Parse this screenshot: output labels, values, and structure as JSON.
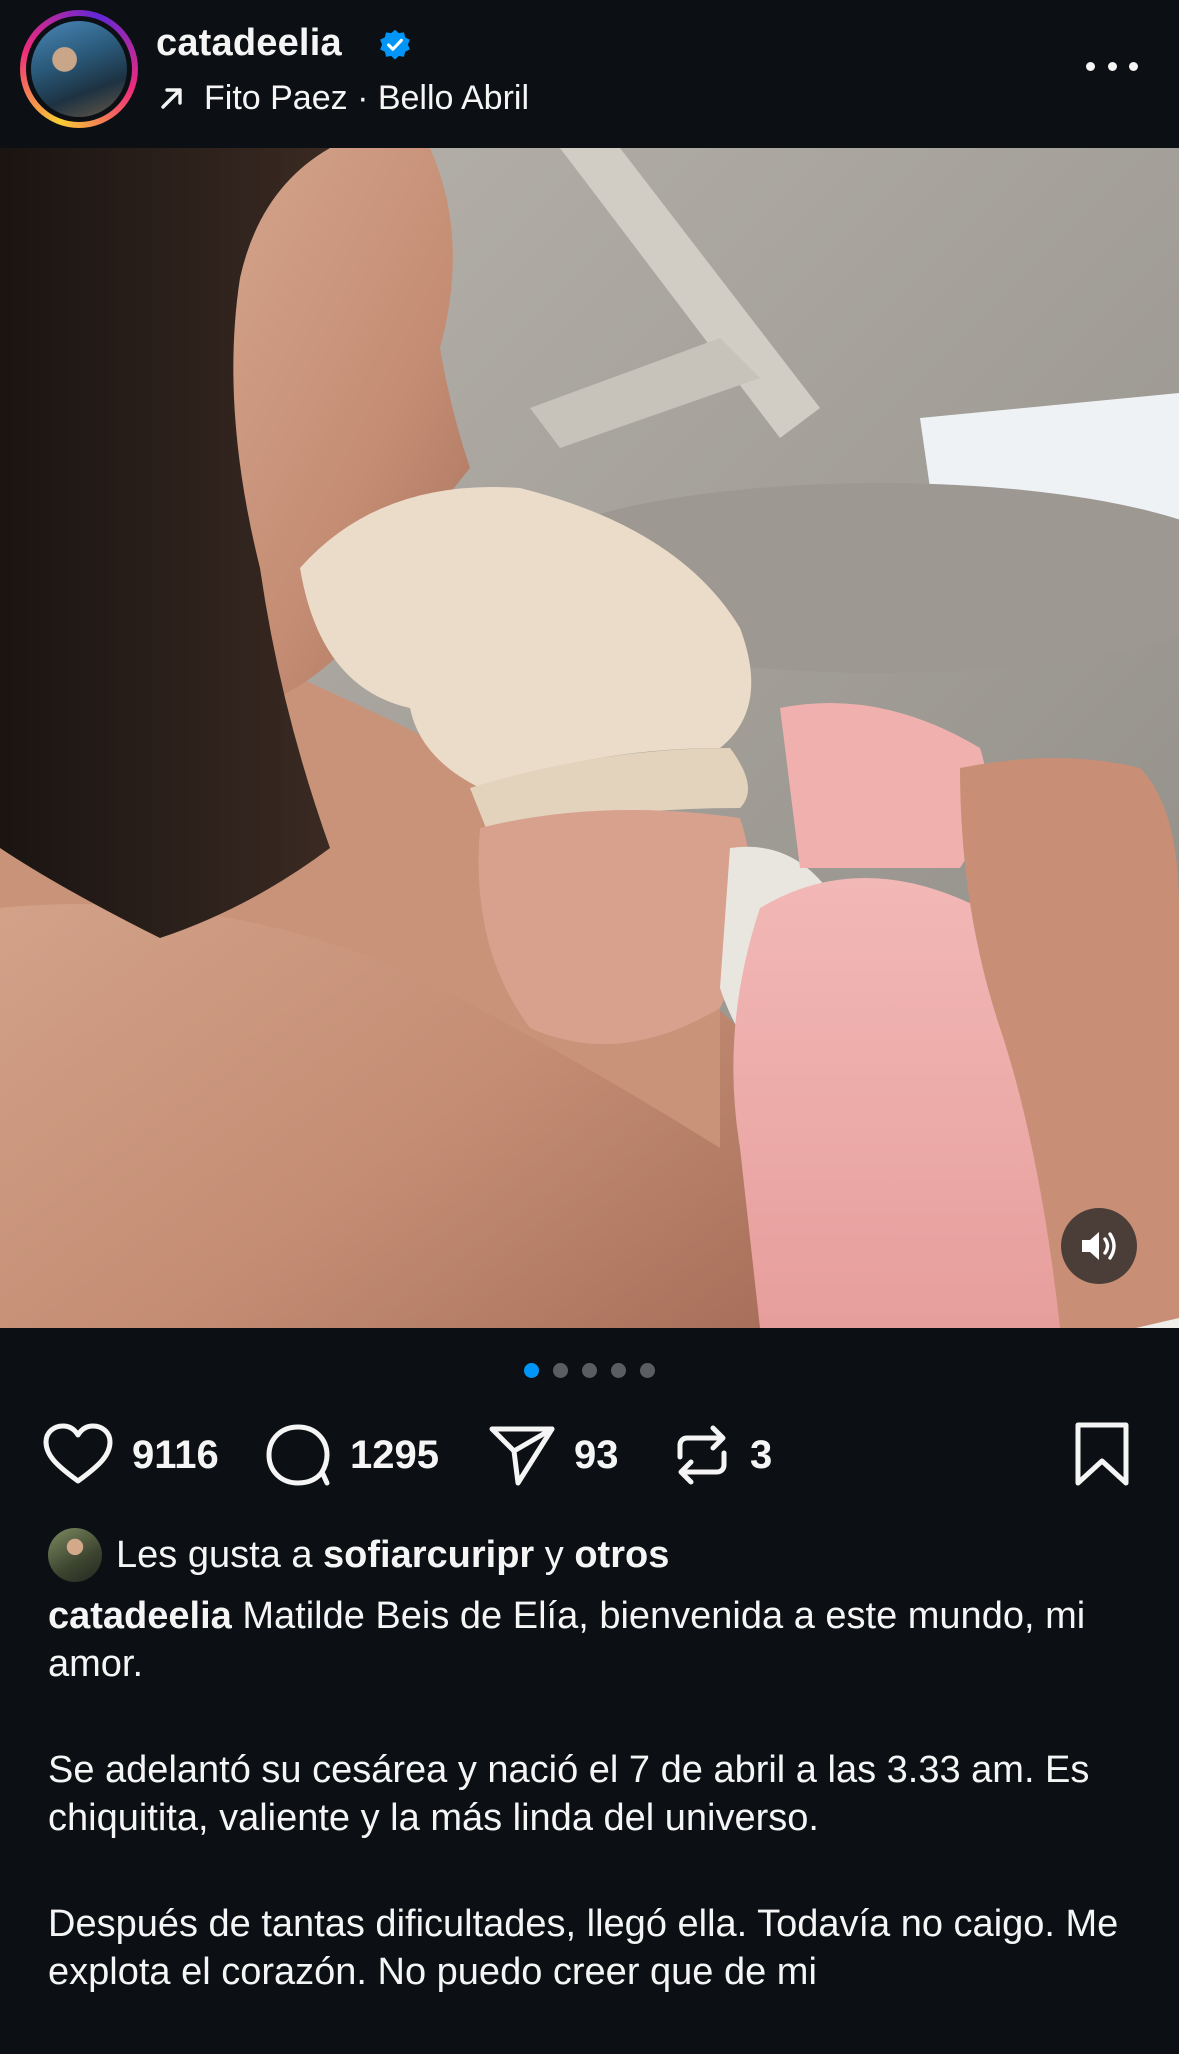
{
  "header": {
    "username": "catadeelia",
    "verified": true,
    "audio": "Fito Paez · Bello Abril"
  },
  "carousel": {
    "total": 5,
    "active_index": 0
  },
  "actions": {
    "likes": "9116",
    "comments": "1295",
    "shares": "93",
    "reposts": "3"
  },
  "liked_by": {
    "prefix": "Les gusta a",
    "user": "sofiarcuripr",
    "connector": "y",
    "others": "otros"
  },
  "caption": {
    "username": "catadeelia",
    "paragraphs": [
      "Matilde Beis de Elía, bienvenida a este mundo, mi amor.",
      "Se adelantó su cesárea y nació el 7 de abril a las 3.33 am. Es chiquitita, valiente y la más linda del universo.",
      "Después de tantas dificultades, llegó ella. Todavía no caigo. Me explota el corazón. No puedo creer que de mi"
    ]
  },
  "colors": {
    "background": "#0c1014",
    "text": "#f5f5f5",
    "accent": "#0095f6",
    "verified": "#0095f6",
    "dot_inactive": "#5a5e63"
  },
  "icons": {
    "verified": "verified-badge-icon",
    "audio": "arrow-up-right-icon",
    "more": "more-horizontal-icon",
    "like": "heart-icon",
    "comment": "comment-bubble-icon",
    "share": "paper-plane-icon",
    "repost": "repost-icon",
    "save": "bookmark-icon",
    "sound": "speaker-icon"
  }
}
